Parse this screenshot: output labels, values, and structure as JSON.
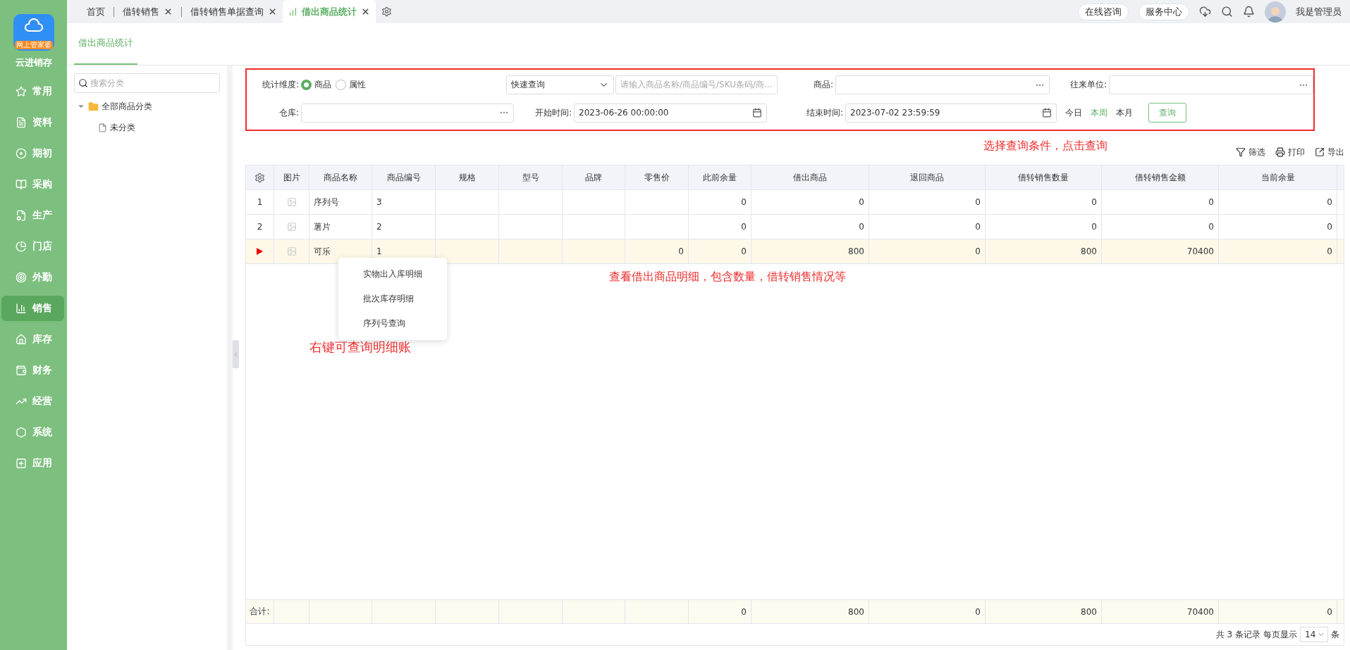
{
  "app": {
    "name": "云进销存",
    "logo_badge": "网上管家婆"
  },
  "nav": [
    {
      "label": "常用",
      "selected": false
    },
    {
      "label": "资料",
      "selected": false
    },
    {
      "label": "期初",
      "selected": false
    },
    {
      "label": "采购",
      "selected": false
    },
    {
      "label": "生产",
      "selected": false
    },
    {
      "label": "门店",
      "selected": false
    },
    {
      "label": "外勤",
      "selected": false
    },
    {
      "label": "销售",
      "selected": true
    },
    {
      "label": "库存",
      "selected": false
    },
    {
      "label": "财务",
      "selected": false
    },
    {
      "label": "经营",
      "selected": false
    },
    {
      "label": "系统",
      "selected": false
    },
    {
      "label": "应用",
      "selected": false
    }
  ],
  "tabs": [
    {
      "label": "首页",
      "closable": false,
      "selected": false
    },
    {
      "label": "借转销售",
      "closable": true,
      "selected": false
    },
    {
      "label": "借转销售单据查询",
      "closable": true,
      "selected": false
    },
    {
      "label": "借出商品统计",
      "closable": true,
      "selected": true
    }
  ],
  "header_actions": [
    "在线咨询",
    "服务中心"
  ],
  "user": {
    "name": "我是管理员"
  },
  "page_tab": "借出商品统计",
  "category_tree": {
    "search_placeholder": "搜索分类",
    "items": [
      {
        "label": "全部商品分类",
        "expanded": true,
        "children": [
          {
            "label": "未分类"
          }
        ]
      }
    ]
  },
  "filters": {
    "dimension_label": "统计维度:",
    "dimension_options": [
      {
        "label": "商品",
        "selected": true
      },
      {
        "label": "属性",
        "selected": false
      }
    ],
    "quick_query": "快速查询",
    "keyword_placeholder": "请输入商品名称/商品编号/SKU条码/商...",
    "product_label": "商品:",
    "partner_label": "往来单位:",
    "warehouse_label": "仓库:",
    "start": {
      "label": "开始时间:",
      "value": "2023-06-26 00:00:00"
    },
    "end": {
      "label": "结束时间:",
      "value": "2023-07-02 23:59:59"
    },
    "ranges": [
      {
        "label": "今日",
        "selected": false
      },
      {
        "label": "本周",
        "selected": true
      },
      {
        "label": "本月",
        "selected": false
      }
    ],
    "query_button": "查询"
  },
  "annotations": {
    "filter_hint": "选择查询条件，点击查询",
    "table_hint": "查看借出商品明细，包含数量，借转销售情况等",
    "menu_hint": "右键可查询明细账"
  },
  "toolbar": [
    {
      "kind": "filter",
      "label": "筛选"
    },
    {
      "kind": "print",
      "label": "打印"
    },
    {
      "kind": "export",
      "label": "导出"
    }
  ],
  "table": {
    "columns": [
      "图片",
      "商品名称",
      "商品编号",
      "规格",
      "型号",
      "品牌",
      "零售价",
      "此前余量",
      "借出商品",
      "退回商品",
      "借转销售数量",
      "借转销售金额",
      "当前余量"
    ],
    "rows": [
      {
        "number": "1",
        "selected": false,
        "cells": [
          "序列号",
          "3",
          null,
          null,
          null,
          null,
          "0",
          "0",
          "0",
          "0",
          "0",
          "0"
        ]
      },
      {
        "number": "2",
        "selected": false,
        "cells": [
          "薯片",
          "2",
          null,
          null,
          null,
          null,
          "0",
          "0",
          "0",
          "0",
          "0",
          "0"
        ]
      },
      {
        "selected": true,
        "cells": [
          "可乐",
          "1",
          null,
          null,
          null,
          "0",
          "0",
          "800",
          "0",
          "800",
          "70400",
          "0"
        ]
      }
    ],
    "totals": {
      "label": "合计:",
      "cells": [
        null,
        null,
        null,
        null,
        null,
        null,
        "0",
        "800",
        "0",
        "800",
        "70400",
        "0"
      ]
    }
  },
  "context_menu": [
    "实物出入库明细",
    "批次库存明细",
    "序列号查询"
  ],
  "pagination": {
    "summary": "共 3 条记录",
    "per_page_label": "每页显示",
    "per_page": "14",
    "unit": "条"
  }
}
